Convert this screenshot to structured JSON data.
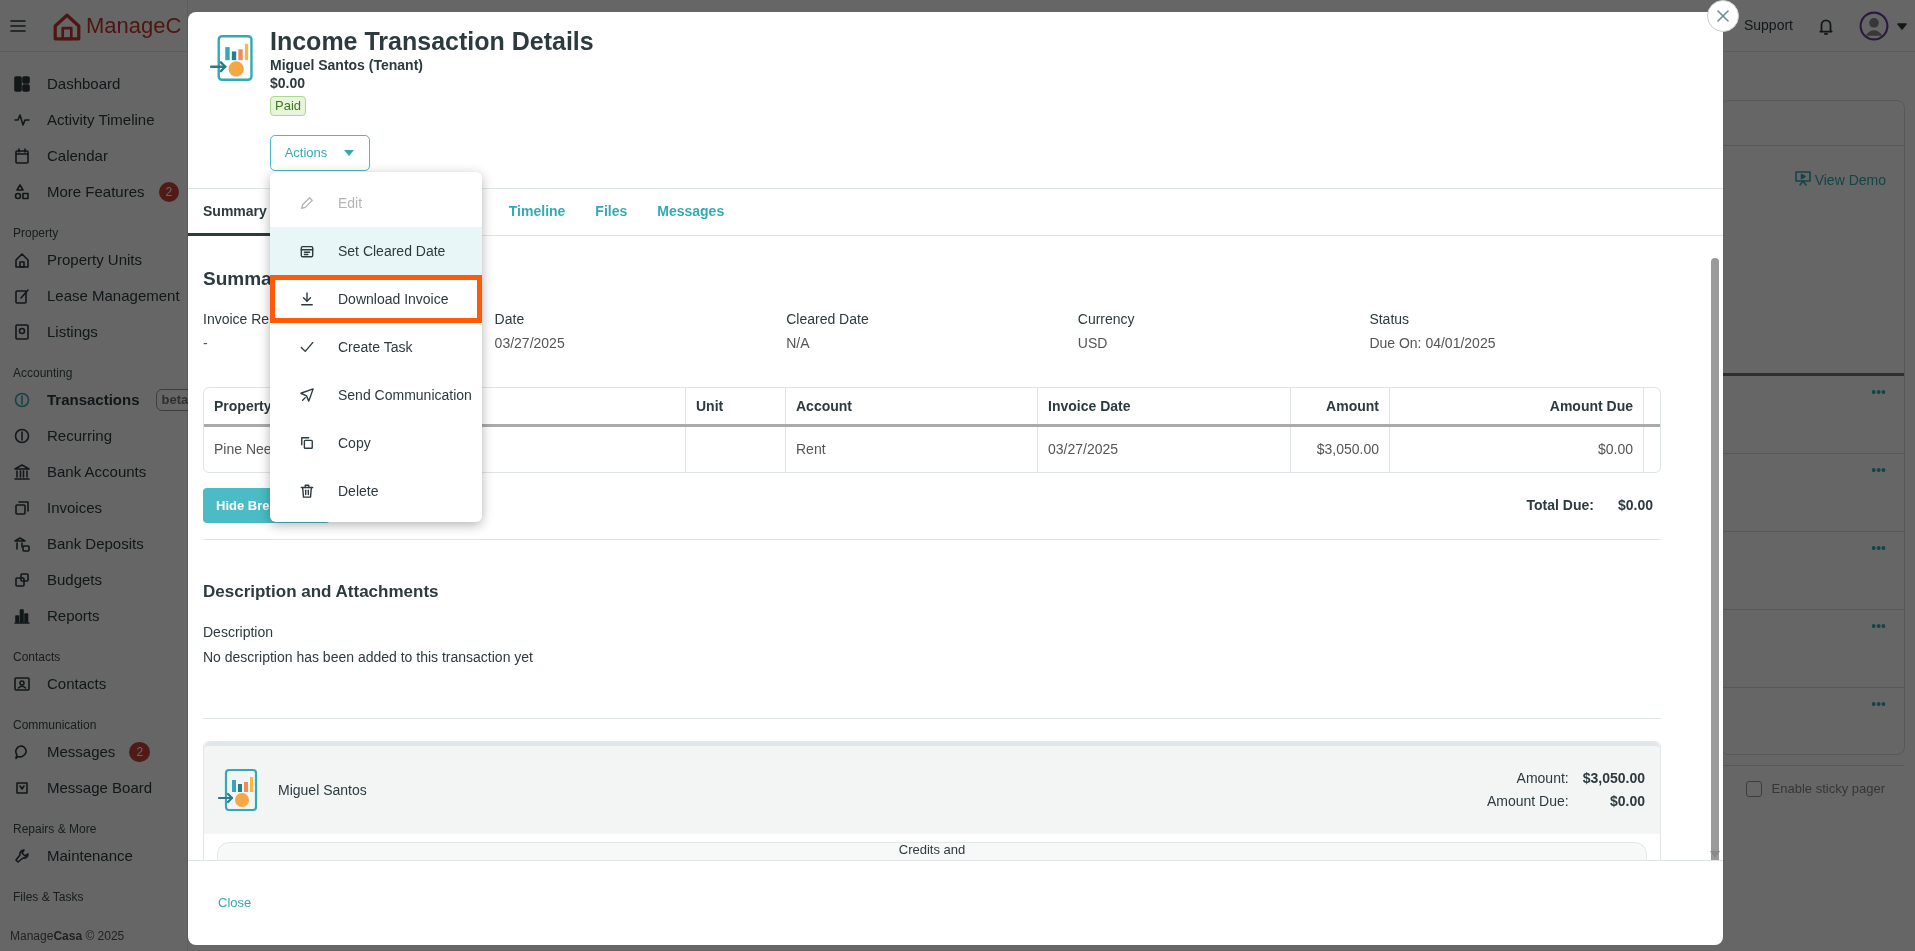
{
  "navbar": {
    "logo_text": "ManageC",
    "support": "Support"
  },
  "sidebar": {
    "sections": [
      {
        "items": [
          {
            "label": "Dashboard",
            "selected": false
          },
          {
            "label": "Activity Timeline",
            "selected": false
          },
          {
            "label": "Calendar",
            "selected": false
          },
          {
            "label": "More Features",
            "selected": false,
            "badge": "2"
          }
        ]
      },
      {
        "title": "Property",
        "items": [
          {
            "label": "Property Units",
            "selected": false
          },
          {
            "label": "Lease Management",
            "selected": false
          },
          {
            "label": "Listings",
            "selected": false
          }
        ]
      },
      {
        "title": "Accounting",
        "items": [
          {
            "label": "Transactions",
            "selected": true,
            "tag": "beta"
          },
          {
            "label": "Recurring",
            "selected": false
          },
          {
            "label": "Bank Accounts",
            "selected": false
          },
          {
            "label": "Invoices",
            "selected": false
          },
          {
            "label": "Bank Deposits",
            "selected": false
          },
          {
            "label": "Budgets",
            "selected": false
          },
          {
            "label": "Reports",
            "selected": false
          }
        ]
      },
      {
        "title": "Contacts",
        "items": [
          {
            "label": "Contacts",
            "selected": false
          }
        ]
      },
      {
        "title": "Communication",
        "items": [
          {
            "label": "Messages",
            "selected": false,
            "badge": "2"
          },
          {
            "label": "Message Board",
            "selected": false
          }
        ]
      },
      {
        "title": "Repairs & More",
        "items": [
          {
            "label": "Maintenance",
            "selected": false
          }
        ]
      },
      {
        "title": "Files & Tasks"
      }
    ],
    "footer": "Manage**Casa** © 2025"
  },
  "background": {
    "view_demo": "View Demo",
    "rows": [
      {
        "menu": "•••"
      },
      {
        "menu": "•••"
      },
      {
        "menu": "•••"
      },
      {
        "menu": "•••"
      },
      {
        "menu": "•••"
      }
    ],
    "sticky_pager": {
      "label": "Enable sticky pager",
      "checked": false
    }
  },
  "modal": {
    "title": "Income Transaction Details",
    "subtitle": "Miguel Santos (Tenant)",
    "amount": "$0.00",
    "status": "Paid",
    "actions": {
      "label": "Actions",
      "items": [
        {
          "label": "Edit",
          "disabled": true,
          "hovered": false,
          "highlighted": false
        },
        {
          "label": "Set Cleared Date",
          "disabled": false,
          "hovered": true,
          "highlighted": false
        },
        {
          "label": "Download Invoice",
          "disabled": false,
          "hovered": false,
          "highlighted": true
        },
        {
          "label": "Create Task",
          "disabled": false,
          "hovered": false,
          "highlighted": false
        },
        {
          "label": "Send Communication",
          "disabled": false,
          "hovered": false,
          "highlighted": false
        },
        {
          "label": "Copy",
          "disabled": false,
          "hovered": false,
          "highlighted": false
        },
        {
          "label": "Delete",
          "disabled": false,
          "hovered": false,
          "highlighted": false
        }
      ]
    },
    "tabs": [
      {
        "label": "Summary",
        "selected": true
      },
      {
        "label": "Timeline",
        "selected": false
      },
      {
        "label": "Files",
        "selected": false
      },
      {
        "label": "Messages",
        "selected": false
      }
    ],
    "summary": {
      "heading": "Summa",
      "fields": [
        {
          "label": "Invoice Re",
          "value": "-"
        },
        {
          "label": "Date",
          "value": "03/27/2025"
        },
        {
          "label": "Cleared Date",
          "value": "N/A"
        },
        {
          "label": "Currency",
          "value": "USD"
        },
        {
          "label": "Status",
          "value": "Due On: 04/01/2025"
        }
      ]
    },
    "table": {
      "columns": [
        "Property",
        null,
        "Unit",
        "Account",
        "Invoice Date",
        "Amount",
        "Amount Due",
        null
      ],
      "rows": [
        [
          "Pine Nee",
          null,
          null,
          "Rent",
          "03/27/2025",
          "$3,050.00",
          "$0.00",
          null
        ]
      ]
    },
    "breakdown_button": "Hide Bre",
    "total": {
      "label": "Total Due:",
      "value": "$0.00"
    },
    "description": {
      "heading": "Description and Attachments",
      "label": "Description",
      "text": "No description has been added to this transaction yet"
    },
    "party": {
      "name": "Miguel Santos",
      "amount_label": "Amount:",
      "amount": "$3,050.00",
      "due_label": "Amount Due:",
      "due": "$0.00",
      "credits_title": "Credits and"
    },
    "close": "Close"
  }
}
